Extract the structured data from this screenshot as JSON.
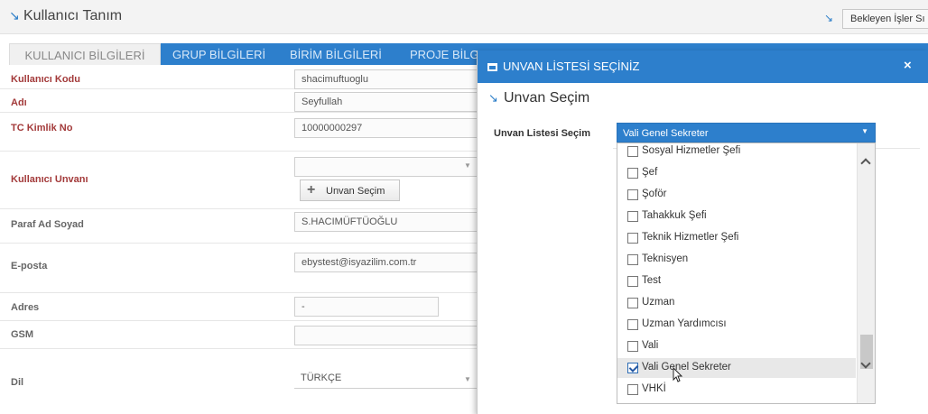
{
  "header": {
    "title": "Kullanıcı Tanım",
    "right_button": "Bekleyen İşler Sı"
  },
  "tabs": [
    {
      "label": "KULLANICI BİLGİLERİ"
    },
    {
      "label": "GRUP BİLGİLERİ"
    },
    {
      "label": "BİRİM BİLGİLERİ"
    },
    {
      "label": "PROJE BİLGİ"
    }
  ],
  "form": {
    "rows": [
      {
        "label": "Kullanıcı Kodu",
        "value": "shacimuftuoglu"
      },
      {
        "label": "Adı",
        "value": "Seyfullah"
      },
      {
        "label": "TC Kimlik No",
        "value": "10000000297"
      },
      {
        "label": "Kullanıcı Unvanı",
        "value": ""
      },
      {
        "label": "Paraf Ad Soyad",
        "value": "S.HACIMÜFTÜOĞLU"
      },
      {
        "label": "E-posta",
        "value": "ebystest@isyazilim.com.tr"
      },
      {
        "label": "Adres",
        "value": "-"
      },
      {
        "label": "GSM",
        "value": ""
      },
      {
        "label": "Dil",
        "value": "TÜRKÇE"
      }
    ],
    "unvan_button": "Unvan Seçim"
  },
  "modal": {
    "title": "UNVAN LİSTESİ SEÇİNİZ",
    "close": "×",
    "subtitle": "Unvan Seçim",
    "select_label": "Unvan Listesi Seçim",
    "select_value": "Vali Genel Sekreter",
    "options": [
      {
        "label": "Sosyal Hizmetler Şefi",
        "checked": false
      },
      {
        "label": "Şef",
        "checked": false
      },
      {
        "label": "Şoför",
        "checked": false
      },
      {
        "label": "Tahakkuk Şefi",
        "checked": false
      },
      {
        "label": "Teknik Hizmetler Şefi",
        "checked": false
      },
      {
        "label": "Teknisyen",
        "checked": false
      },
      {
        "label": "Test",
        "checked": false
      },
      {
        "label": "Uzman",
        "checked": false
      },
      {
        "label": "Uzman Yardımcısı",
        "checked": false
      },
      {
        "label": "Vali",
        "checked": false
      },
      {
        "label": "Vali Genel Sekreter",
        "checked": true
      },
      {
        "label": "VHKİ",
        "checked": false
      }
    ]
  },
  "colors": {
    "accent": "#2d7fcc",
    "required_label": "#a33a3a"
  }
}
